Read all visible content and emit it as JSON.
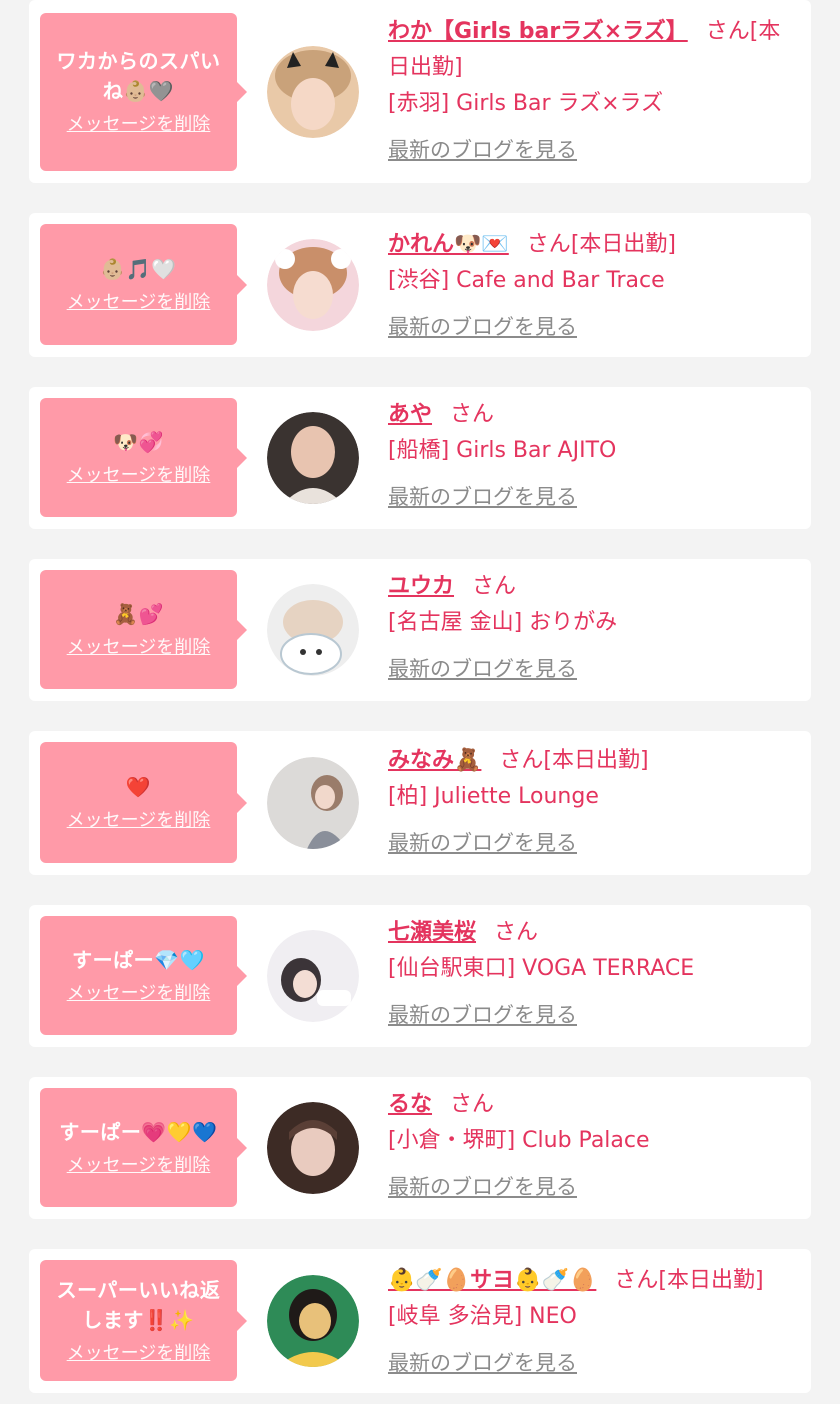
{
  "cards": [
    {
      "message": "ワカからのスパいね👶🏼🩶",
      "delete_label": "メッセージを削除",
      "name": "わか【Girls barラズ×ラズ】",
      "honorific": "さん",
      "status": "[本日出勤]",
      "shop": "[赤羽] Girls Bar ラズ×ラズ",
      "blog_label": "最新のブログを見る",
      "avatar_colors": [
        "#e9c9a8",
        "#4a3a33"
      ]
    },
    {
      "message": "👶🏼🎵🤍",
      "delete_label": "メッセージを削除",
      "name": "かれん🐶💌",
      "honorific": "さん",
      "status": "[本日出勤]",
      "shop": "[渋谷] Cafe and Bar Trace",
      "blog_label": "最新のブログを見る",
      "avatar_colors": [
        "#f4d6dc",
        "#c98f6a"
      ]
    },
    {
      "message": "🐶💞",
      "delete_label": "メッセージを削除",
      "name": "あや",
      "honorific": "さん",
      "status": "",
      "shop": "[船橋] Girls Bar AJITO",
      "blog_label": "最新のブログを見る",
      "avatar_colors": [
        "#3a3330",
        "#e8c4b0"
      ]
    },
    {
      "message": "🧸💕",
      "delete_label": "メッセージを削除",
      "name": "ユウカ",
      "honorific": "さん",
      "status": "",
      "shop": "[名古屋 金山] おりがみ",
      "blog_label": "最新のブログを見る",
      "avatar_colors": [
        "#eeeeee",
        "#b9c8d2"
      ]
    },
    {
      "message": "❤️",
      "delete_label": "メッセージを削除",
      "name": "みなみ🧸",
      "honorific": "さん",
      "status": "[本日出勤]",
      "shop": "[柏] Juliette Lounge",
      "blog_label": "最新のブログを見る",
      "avatar_colors": [
        "#dcdad8",
        "#9a7c6a"
      ]
    },
    {
      "message": "すーぱー💎🩵",
      "delete_label": "メッセージを削除",
      "name": "七瀬美桜",
      "honorific": "さん",
      "status": "",
      "shop": "[仙台駅東口] VOGA TERRACE",
      "blog_label": "最新のブログを見る",
      "avatar_colors": [
        "#f0eef2",
        "#3b3438"
      ]
    },
    {
      "message": "すーぱー💗💛💙",
      "delete_label": "メッセージを削除",
      "name": "るな",
      "honorific": "さん",
      "status": "",
      "shop": "[小倉・堺町] Club Palace",
      "blog_label": "最新のブログを見る",
      "avatar_colors": [
        "#3d2b25",
        "#e9cbbf"
      ]
    },
    {
      "message": "スーパーいいね返します‼️✨",
      "delete_label": "メッセージを削除",
      "name": "👶🍼🥚サヨ👶🍼🥚",
      "honorific": "さん",
      "status": "[本日出勤]",
      "shop": "[岐阜 多治見] NEO",
      "blog_label": "最新のブログを見る",
      "avatar_colors": [
        "#2e8b57",
        "#e8c17a"
      ]
    }
  ]
}
